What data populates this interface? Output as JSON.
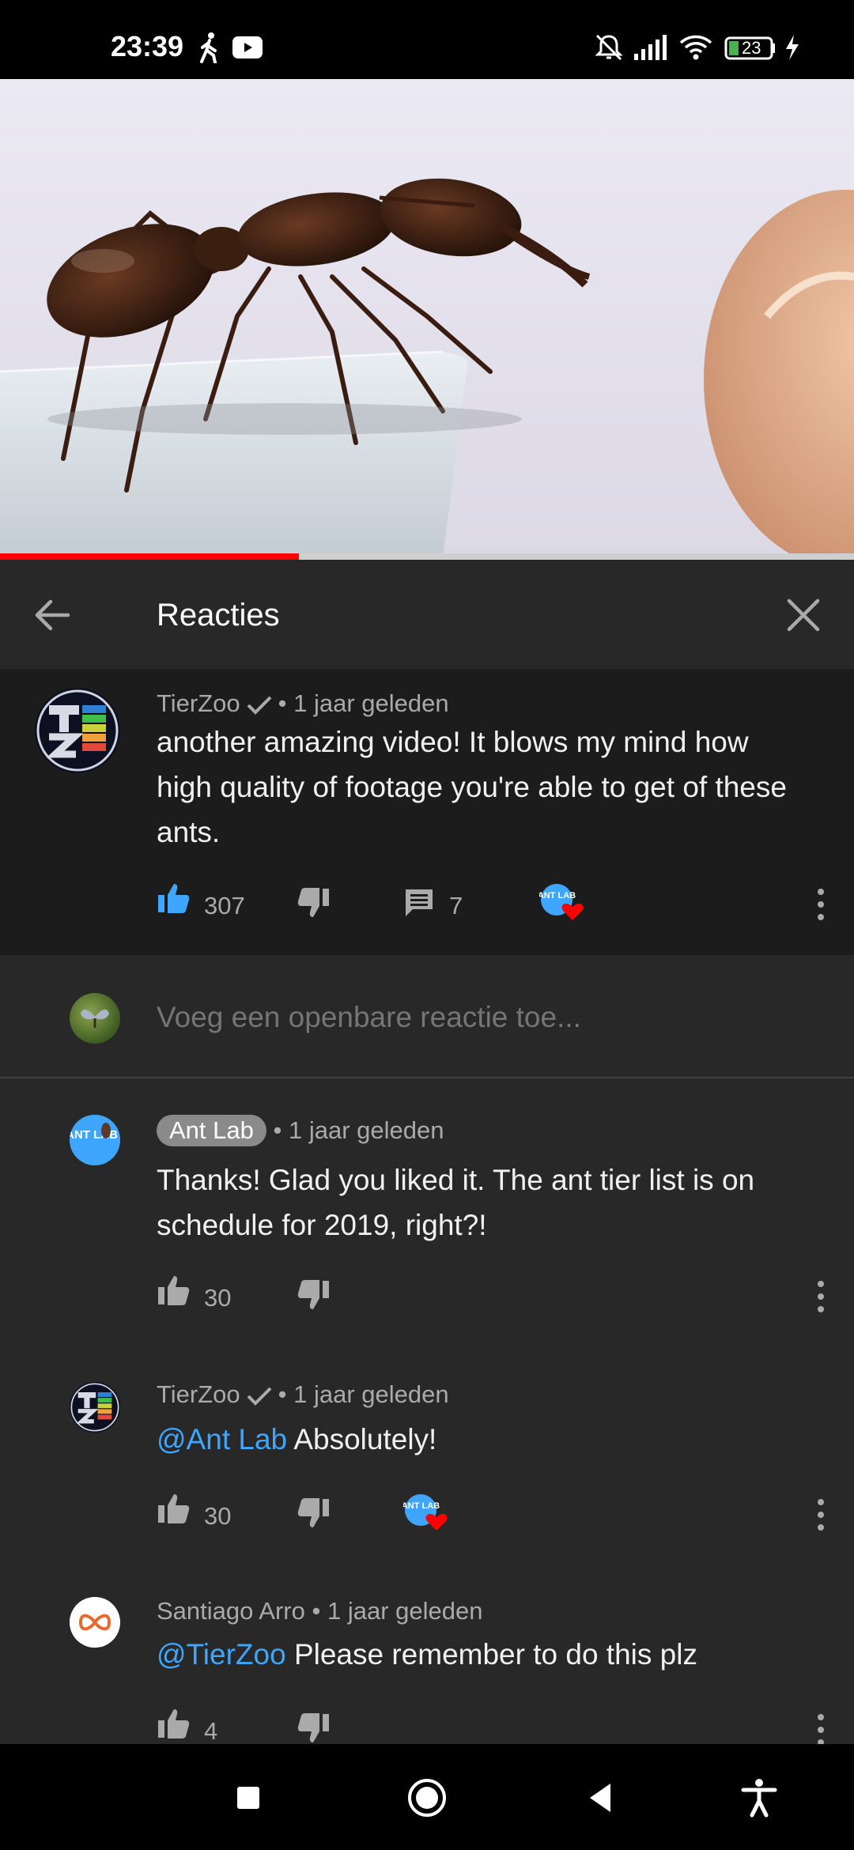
{
  "status_bar": {
    "time": "23:39",
    "battery": "23",
    "icons": [
      "walk-icon",
      "youtube-icon",
      "mute-icon",
      "signal-icon",
      "wifi-icon",
      "battery-icon",
      "charging-icon"
    ]
  },
  "video": {
    "progress": 0.35,
    "accent": "#ff0000"
  },
  "comments_header": {
    "title": "Reacties"
  },
  "top_comment": {
    "author": "TierZoo",
    "time": "1 jaar geleden",
    "text": "another amazing video! It blows my mind how high quality of footage you're able to get of these ants.",
    "likes": "307",
    "replies": "7"
  },
  "reply_input": {
    "placeholder": "Voeg een openbare reactie toe..."
  },
  "replies": [
    {
      "author": "Ant Lab",
      "time": "1 jaar geleden",
      "text": "Thanks! Glad you liked it. The ant tier list is on schedule for 2019, right?!",
      "likes": "30"
    },
    {
      "author": "TierZoo",
      "time": "1 jaar geleden",
      "mention": "@Ant Lab",
      "text": " Absolutely!",
      "likes": "30"
    },
    {
      "author": "Santiago Arro",
      "time": "1 jaar geleden",
      "mention": "@TierZoo",
      "text": " Please remember to do this plz",
      "likes": "4"
    }
  ],
  "separator": "•",
  "avatar_text": {
    "antlab": "ANT LAB"
  },
  "colors": {
    "link": "#3ea6ff",
    "like_active": "#3ea6ff",
    "heart": "#ff0000"
  }
}
